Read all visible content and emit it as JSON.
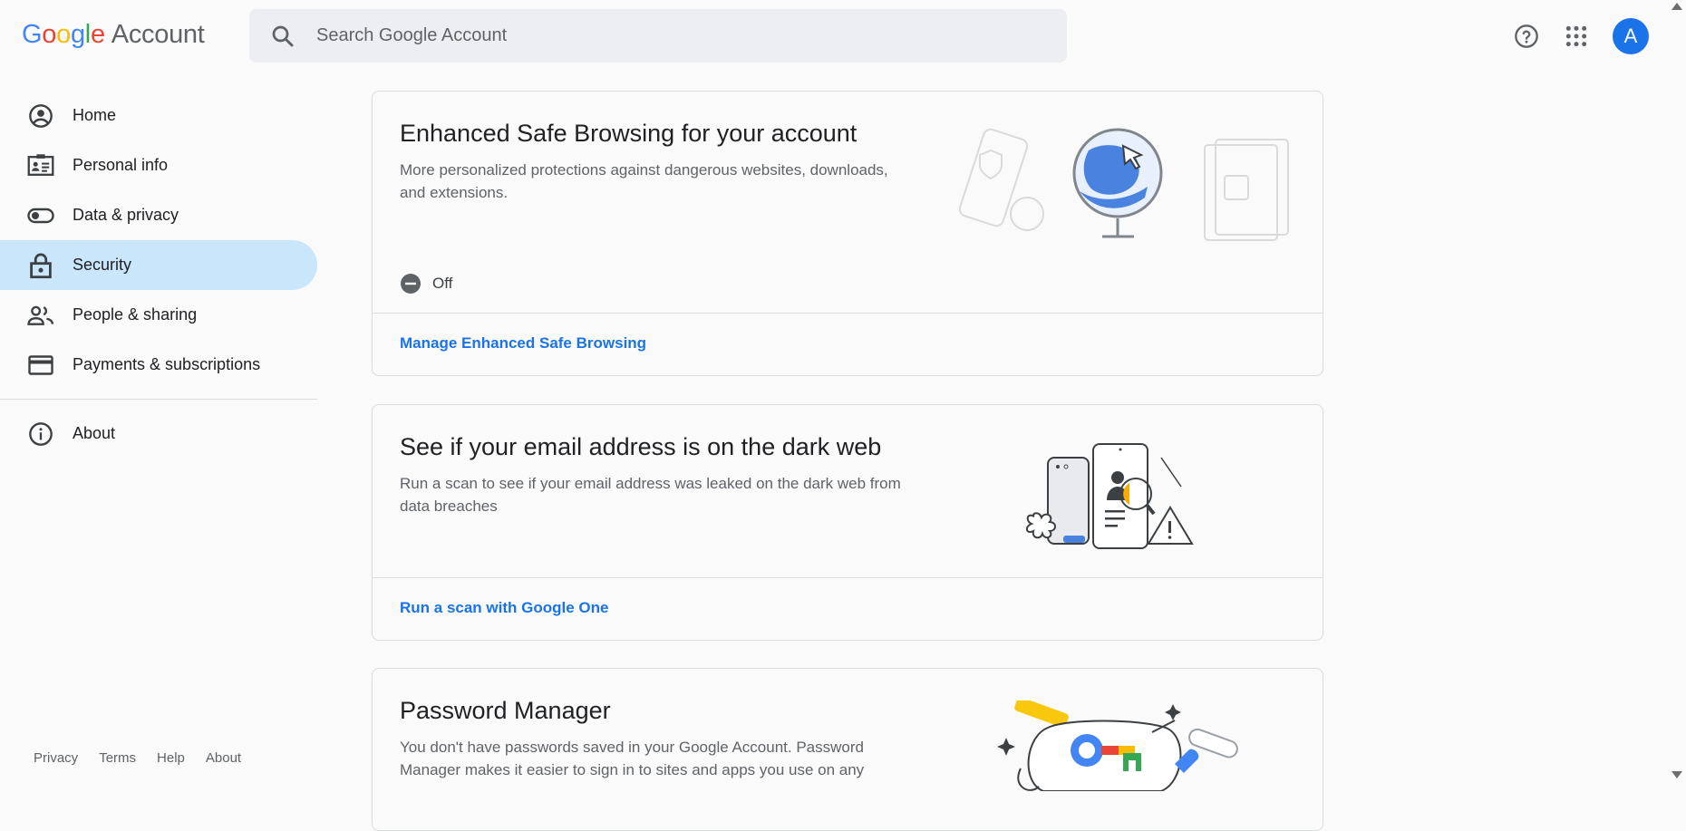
{
  "header": {
    "logo": {
      "google": [
        "G",
        "o",
        "o",
        "g",
        "l",
        "e"
      ],
      "account": "Account"
    },
    "search": {
      "placeholder": "Search Google Account",
      "value": ""
    },
    "help_icon": "help-circle-icon",
    "apps_icon": "apps-grid-icon",
    "avatar_letter": "A"
  },
  "sidebar": {
    "items": [
      {
        "label": "Home",
        "icon": "account-circle-icon"
      },
      {
        "label": "Personal info",
        "icon": "badge-icon"
      },
      {
        "label": "Data & privacy",
        "icon": "toggle-icon"
      },
      {
        "label": "Security",
        "icon": "lock-icon",
        "active": true
      },
      {
        "label": "People & sharing",
        "icon": "people-icon"
      },
      {
        "label": "Payments & subscriptions",
        "icon": "credit-card-icon"
      }
    ],
    "about": {
      "label": "About",
      "icon": "info-icon"
    }
  },
  "footer": {
    "links": [
      "Privacy",
      "Terms",
      "Help",
      "About"
    ]
  },
  "cards": {
    "safe_browsing": {
      "title": "Enhanced Safe Browsing for your account",
      "description": "More personalized protections against dangerous websites, downloads, and extensions.",
      "status": "Off",
      "link": "Manage Enhanced Safe Browsing"
    },
    "dark_web": {
      "title": "See if your email address is on the dark web",
      "description": "Run a scan to see if your email address was leaked on the dark web from data breaches",
      "link": "Run a scan with Google One"
    },
    "password_manager": {
      "title": "Password Manager",
      "description": "You don't have passwords saved in your Google Account. Password Manager makes it easier to sign in to sites and apps you use on any"
    }
  },
  "colors": {
    "accent": "#1a73e8",
    "active_nav": "#c9e6fa",
    "border": "#dadce0"
  }
}
